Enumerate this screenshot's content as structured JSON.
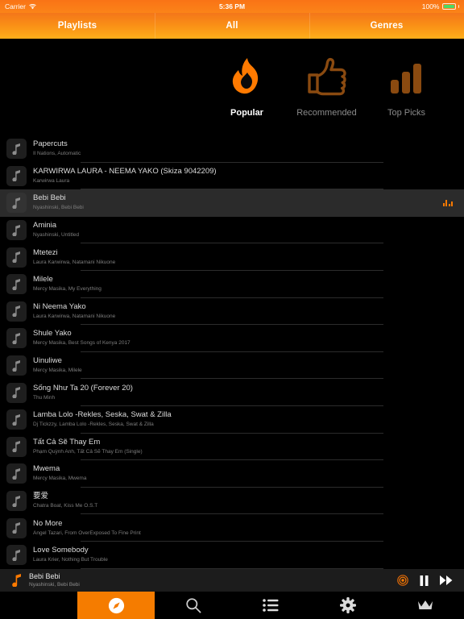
{
  "status_bar": {
    "carrier": "Carrier",
    "wifi_icon": "wifi-icon",
    "time": "5:36 PM",
    "battery_percent": "100%"
  },
  "header": {
    "tabs": [
      {
        "label": "Playlists",
        "name": "segment-playlists"
      },
      {
        "label": "All",
        "name": "segment-all"
      },
      {
        "label": "Genres",
        "name": "segment-genres"
      }
    ]
  },
  "categories": [
    {
      "label": "Popular",
      "icon": "flame-icon",
      "active": true
    },
    {
      "label": "Recommended",
      "icon": "thumbs-up-icon",
      "active": false
    },
    {
      "label": "Top Picks",
      "icon": "bar-chart-icon",
      "active": false
    }
  ],
  "colors": {
    "accent": "#f57c00",
    "accent_bright": "#ff7a00",
    "header_gradient_start": "#f4761a",
    "header_gradient_end": "#ffae1a",
    "background": "#000000",
    "row_selected": "#2b2b2b",
    "battery_green": "#4cd964"
  },
  "tracks": [
    {
      "title": "Papercuts",
      "subtitle": "Il Nations, Automatic",
      "playing": false
    },
    {
      "title": "KARWIRWA LAURA - NEEMA YAKO (Skiza 9042209)",
      "subtitle": "Karwirwa Laura",
      "playing": false
    },
    {
      "title": "Bebi Bebi",
      "subtitle": "Nyashinski, Bebi Bebi",
      "playing": true
    },
    {
      "title": "Aminia",
      "subtitle": "Nyashinski, Untitled",
      "playing": false
    },
    {
      "title": "Mtetezi",
      "subtitle": "Laura Karwirwa, Natamani Nikuone",
      "playing": false
    },
    {
      "title": "Milele",
      "subtitle": "Mercy Masika, My Everything",
      "playing": false
    },
    {
      "title": "Ni Neema Yako",
      "subtitle": "Laura Karwirwa, Natamani Nikuone",
      "playing": false
    },
    {
      "title": "Shule Yako",
      "subtitle": "Mercy Masika, Best Songs of Kenya 2017",
      "playing": false
    },
    {
      "title": "Uinuliwe",
      "subtitle": "Mercy Masika, Milele",
      "playing": false
    },
    {
      "title": "Sống Như Ta 20 (Forever 20)",
      "subtitle": "Thu Minh",
      "playing": false
    },
    {
      "title": "Lamba Lolo -Rekles, Seska, Swat & Zilla",
      "subtitle": "Dj Tickzzy, Lamba Lolo -Rekles, Seska, Swat & Zilla",
      "playing": false
    },
    {
      "title": "Tất Cả Sẽ Thay Em",
      "subtitle": "Phạm Quỳnh Anh, Tất Cả Sẽ Thay Em (Single)",
      "playing": false
    },
    {
      "title": "Mwema",
      "subtitle": "Mercy Masika, Mwema",
      "playing": false
    },
    {
      "title": "要爱",
      "subtitle": "Chatra Boat, Kiss Me O.S.T",
      "playing": false
    },
    {
      "title": "No More",
      "subtitle": "Angel Tazari, From OverExposed To Fine Print",
      "playing": false
    },
    {
      "title": "Love Somebody",
      "subtitle": "Laura Krier, Nothing But Trouble",
      "playing": false
    }
  ],
  "now_playing": {
    "title": "Bebi Bebi",
    "subtitle": "Nyashinski, Bebi Bebi",
    "note_icon": "music-note-icon",
    "broadcast_icon": "broadcast-icon",
    "pause_icon": "pause-icon",
    "next_icon": "fast-forward-icon"
  },
  "tab_bar": [
    {
      "name": "tab-discover",
      "icon": "compass-icon",
      "active": true
    },
    {
      "name": "tab-search",
      "icon": "search-icon",
      "active": false
    },
    {
      "name": "tab-playlist",
      "icon": "list-icon",
      "active": false
    },
    {
      "name": "tab-settings",
      "icon": "gear-icon",
      "active": false
    },
    {
      "name": "tab-premium",
      "icon": "crown-icon",
      "active": false
    }
  ]
}
